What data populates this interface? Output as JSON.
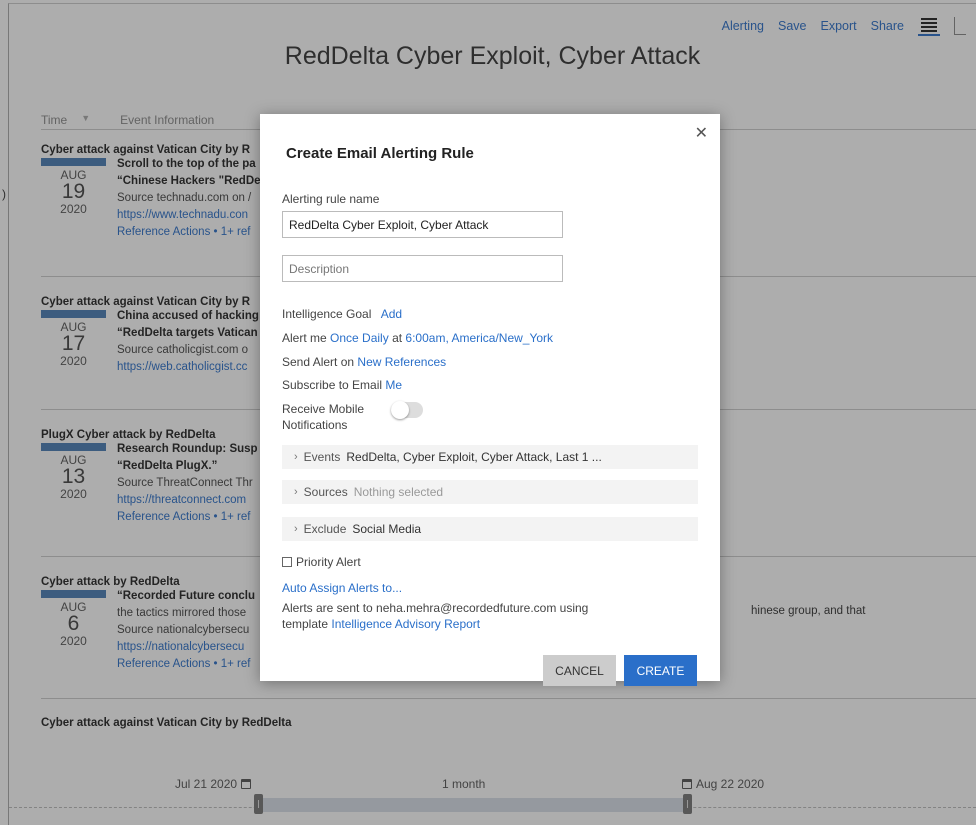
{
  "nav": {
    "alerting": "Alerting",
    "save": "Save",
    "export": "Export",
    "share": "Share"
  },
  "page_title": "RedDelta Cyber Exploit, Cyber Attack",
  "table_header": {
    "time": "Time",
    "event_info": "Event Information"
  },
  "left_mark": ")",
  "events": [
    {
      "title": "Cyber attack against Vatican City by R",
      "month": "AUG",
      "day": "19",
      "year": "2020",
      "lines": [
        {
          "text": "Scroll to the top of the pa",
          "style": "bold"
        },
        {
          "text": "“Chinese Hackers \"RedDe",
          "style": "bold"
        },
        {
          "text": "Source technadu.com on /",
          "style": "src"
        },
        {
          "text": "https://www.technadu.con",
          "style": "lnk"
        },
        {
          "text": "Reference Actions • 1+ ref",
          "style": "lnk"
        }
      ],
      "right": ""
    },
    {
      "title": "Cyber attack against Vatican City by R",
      "month": "AUG",
      "day": "17",
      "year": "2020",
      "lines": [
        {
          "text": "China accused of hacking",
          "style": "bold"
        },
        {
          "text": "“RedDelta targets Vatican",
          "style": "bold"
        },
        {
          "text": "Source catholicgist.com o",
          "style": "src"
        },
        {
          "text": "https://web.catholicgist.cc",
          "style": "lnk"
        }
      ],
      "right": ""
    },
    {
      "title": "PlugX Cyber attack by RedDelta",
      "month": "AUG",
      "day": "13",
      "year": "2020",
      "lines": [
        {
          "text": "Research Roundup: Susp",
          "style": "bold"
        },
        {
          "text": "“RedDelta PlugX.”",
          "style": "bold"
        },
        {
          "text": "Source ThreatConnect Thr",
          "style": "src"
        },
        {
          "text": "https://threatconnect.com",
          "style": "lnk"
        },
        {
          "text": "Reference Actions • 1+ ref",
          "style": "lnk"
        }
      ],
      "right": ""
    },
    {
      "title": "Cyber attack by RedDelta",
      "month": "AUG",
      "day": "6",
      "year": "2020",
      "lines": [
        {
          "text": "“Recorded Future conclu",
          "style": "bold"
        },
        {
          "text": "the tactics mirrored those",
          "style": "src"
        },
        {
          "text": "Source nationalcybersecu",
          "style": "src"
        },
        {
          "text": "https://nationalcybersecu",
          "style": "lnk"
        },
        {
          "text": "Reference Actions • 1+ ref",
          "style": "lnk"
        }
      ],
      "right": "hinese group, and that"
    }
  ],
  "last_event_title": "Cyber attack against Vatican City by RedDelta",
  "timeline": {
    "start": "Jul 21 2020",
    "span": "1 month",
    "end": "Aug 22 2020"
  },
  "modal": {
    "title": "Create Email Alerting Rule",
    "rule_name_label": "Alerting rule name",
    "rule_name_value": "RedDelta Cyber Exploit, Cyber Attack",
    "description_placeholder": "Description",
    "intel_goal_label": "Intelligence Goal",
    "intel_goal_action": "Add",
    "alert_me_prefix": "Alert me",
    "alert_frequency": "Once Daily",
    "alert_at": "at",
    "alert_time": "6:00am,",
    "alert_timezone": "America/New_York",
    "send_alert_label": "Send Alert on",
    "send_alert_value": "New References",
    "subscribe_label": "Subscribe to Email",
    "subscribe_value": "Me",
    "mobile_label_1": "Receive Mobile",
    "mobile_label_2": "Notifications",
    "mobile_enabled": false,
    "filters": [
      {
        "key": "Events",
        "value": "RedDelta, Cyber Exploit, Cyber Attack, Last 1 ...",
        "muted": false
      },
      {
        "key": "Sources",
        "value": "Nothing selected",
        "muted": true
      },
      {
        "key": "Exclude",
        "value": "Social Media",
        "muted": false
      }
    ],
    "priority_label": "Priority Alert",
    "auto_assign": "Auto Assign Alerts to...",
    "sent_to_line": "Alerts are sent to neha.mehra@recordedfuture.com using",
    "template_prefix": "template",
    "template_name": "Intelligence Advisory Report",
    "cancel": "CANCEL",
    "create": "CREATE"
  },
  "colors": {
    "accent": "#2a6fc9",
    "date_bar": "#4a7db5"
  }
}
